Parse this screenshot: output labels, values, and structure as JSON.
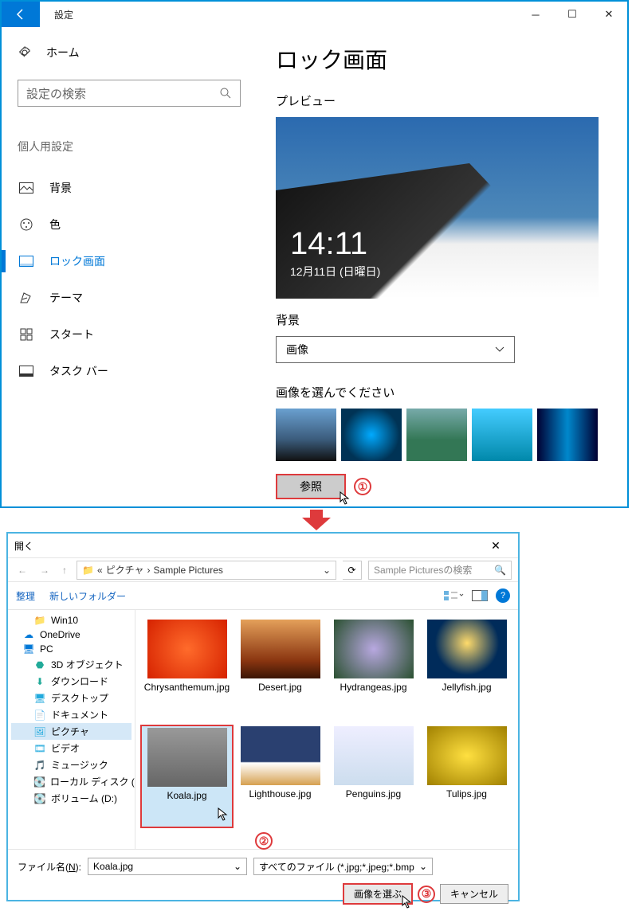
{
  "settings": {
    "title": "設定",
    "home": "ホーム",
    "search_placeholder": "設定の検索",
    "section": "個人用設定",
    "nav": {
      "background": "背景",
      "color": "色",
      "lock": "ロック画面",
      "theme": "テーマ",
      "start": "スタート",
      "taskbar": "タスク バー"
    },
    "page_title": "ロック画面",
    "preview_label": "プレビュー",
    "preview_time": "14:11",
    "preview_date": "12月11日 (日曜日)",
    "bg_label": "背景",
    "bg_value": "画像",
    "choose_label": "画像を選んでください",
    "browse": "参照"
  },
  "annotations": {
    "n1": "①",
    "n2": "②",
    "n3": "③"
  },
  "dialog": {
    "title": "開く",
    "path_seg1": "ピクチャ",
    "path_seg2": "Sample Pictures",
    "search_placeholder": "Sample Picturesの検索",
    "organize": "整理",
    "new_folder": "新しいフォルダー",
    "tree": {
      "win10": "Win10",
      "onedrive": "OneDrive",
      "pc": "PC",
      "objects3d": "3D オブジェクト",
      "downloads": "ダウンロード",
      "desktop": "デスクトップ",
      "documents": "ドキュメント",
      "pictures": "ピクチャ",
      "videos": "ビデオ",
      "music": "ミュージック",
      "localdisk": "ローカル ディスク (C",
      "volume": "ボリューム (D:)"
    },
    "files": {
      "chrys": "Chrysanthemum.jpg",
      "desert": "Desert.jpg",
      "hydra": "Hydrangeas.jpg",
      "jelly": "Jellyfish.jpg",
      "koala": "Koala.jpg",
      "light": "Lighthouse.jpg",
      "peng": "Penguins.jpg",
      "tulip": "Tulips.jpg"
    },
    "filename_label_pre": "ファイル名(",
    "filename_label_u": "N",
    "filename_label_post": "):",
    "filename_value": "Koala.jpg",
    "filter": "すべてのファイル (*.jpg;*.jpeg;*.bmp",
    "open_btn": "画像を選ぶ",
    "cancel_btn": "キャンセル"
  }
}
